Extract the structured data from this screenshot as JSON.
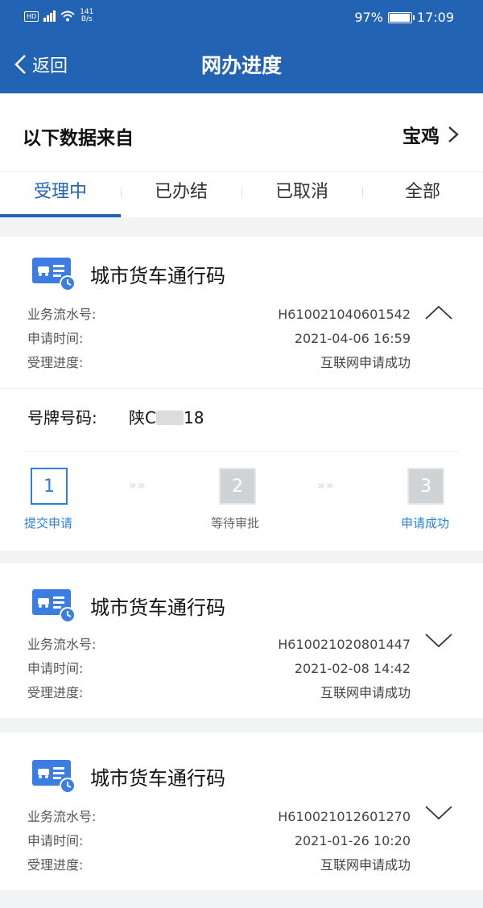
{
  "status_bar": {
    "hd": "HD",
    "network": "4G",
    "speed": "141\nB/s",
    "battery": "97%",
    "time": "17:09"
  },
  "nav": {
    "back_label": "返回",
    "title": "网办进度"
  },
  "source": {
    "label": "以下数据来自",
    "city": "宝鸡"
  },
  "tabs": [
    {
      "label": "受理中",
      "active": true
    },
    {
      "label": "已办结",
      "active": false
    },
    {
      "label": "已取消",
      "active": false
    },
    {
      "label": "全部",
      "active": false
    }
  ],
  "field_labels": {
    "serial": "业务流水号:",
    "apply_time": "申请时间:",
    "progress": "受理进度:",
    "plate": "号牌号码:"
  },
  "cards": [
    {
      "title": "城市货车通行码",
      "serial": "H610021040601542",
      "apply_time": "2021-04-06 16:59",
      "progress": "互联网申请成功",
      "expanded": true,
      "plate_prefix": "陕C",
      "plate_suffix": "18",
      "steps": [
        {
          "num": "1",
          "label": "提交申请",
          "state": "active"
        },
        {
          "num": "2",
          "label": "等待审批",
          "state": "inactive"
        },
        {
          "num": "3",
          "label": "申请成功",
          "state": "inactive"
        }
      ]
    },
    {
      "title": "城市货车通行码",
      "serial": "H610021020801447",
      "apply_time": "2021-02-08 14:42",
      "progress": "互联网申请成功",
      "expanded": false
    },
    {
      "title": "城市货车通行码",
      "serial": "H610021012601270",
      "apply_time": "2021-01-26 10:20",
      "progress": "互联网申请成功",
      "expanded": false
    }
  ],
  "colors": {
    "primary": "#2363b4",
    "step_active": "#2f80d8",
    "background": "#f2f3f5"
  }
}
